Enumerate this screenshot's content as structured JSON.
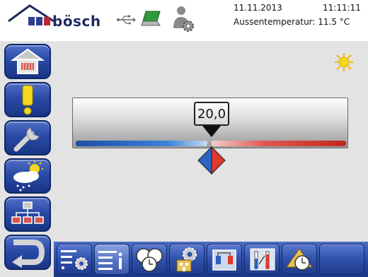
{
  "header": {
    "brand": "bösch",
    "date": "11.11.2013",
    "time": "11:11:11",
    "outside_temperature": "Aussentemperatur: 11.5 °C"
  },
  "sidebar": {
    "items": [
      {
        "name": "home",
        "icon": "house-icon"
      },
      {
        "name": "alarm",
        "icon": "exclamation-icon"
      },
      {
        "name": "service",
        "icon": "wrench-icon"
      },
      {
        "name": "weather",
        "icon": "weather-icon"
      },
      {
        "name": "network",
        "icon": "network-icon"
      },
      {
        "name": "back",
        "icon": "back-arrow-icon"
      }
    ]
  },
  "setpoint": {
    "value": "20,0",
    "position": 0.5
  },
  "mode_icon": "sun-icon",
  "toolbar": {
    "items": [
      {
        "name": "settings-list",
        "icon": "settings-list-icon",
        "active": false
      },
      {
        "name": "info-list",
        "icon": "info-list-icon",
        "active": true
      },
      {
        "name": "schedules",
        "icon": "clocks-icon",
        "active": false
      },
      {
        "name": "system-settings",
        "icon": "gear-building-icon",
        "active": false
      },
      {
        "name": "heating-circuit",
        "icon": "heating-circuit-icon",
        "active": false
      },
      {
        "name": "thermometers",
        "icon": "thermometers-icon",
        "active": false
      },
      {
        "name": "timer-alarm",
        "icon": "timer-alarm-icon",
        "active": false
      }
    ]
  },
  "colors": {
    "accent_blue": "#2a4aa6",
    "cold_blue": "#1e4ea5",
    "hot_red": "#c0281f",
    "background_gray": "#e3e3e3"
  }
}
